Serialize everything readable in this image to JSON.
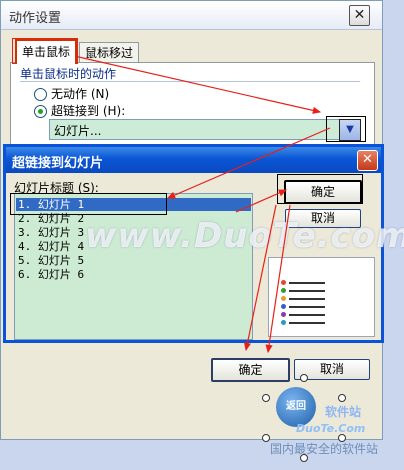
{
  "back_dialog": {
    "title": "动作设置",
    "close_glyph": "✕",
    "tabs": [
      {
        "label": "单击鼠标",
        "active": true
      },
      {
        "label": "鼠标移过",
        "active": false
      }
    ],
    "group_label": "单击鼠标时的动作",
    "radio_none": {
      "label": "无动作 (N)",
      "checked": false
    },
    "radio_link": {
      "label": "超链接到 (H):",
      "checked": true
    },
    "link_value": "幻灯片...",
    "ok_label": "确定",
    "cancel_label": "取消"
  },
  "front_dialog": {
    "title": "超链接到幻灯片",
    "close_glyph": "✕",
    "list_label": "幻灯片标题 (S):",
    "slides": [
      {
        "label": "1. 幻灯片 1",
        "selected": true
      },
      {
        "label": "2. 幻灯片 2",
        "selected": false
      },
      {
        "label": "3. 幻灯片 3",
        "selected": false
      },
      {
        "label": "4. 幻灯片 4",
        "selected": false
      },
      {
        "label": "5. 幻灯片 5",
        "selected": false
      },
      {
        "label": "6. 幻灯片 6",
        "selected": false
      }
    ],
    "ok_label": "确定",
    "cancel_label": "取消"
  },
  "watermark": {
    "center": "www.DuoTe.com",
    "badge": "返回",
    "line1": "软件站",
    "line2": "DuoTe.Com",
    "line3": "国内最安全的软件站"
  },
  "colors": {
    "annotation_arrow": "#e8201a",
    "selection": "#316ac5",
    "titlebar_blue": "#0a56d6",
    "list_background": "#cdebd3"
  }
}
